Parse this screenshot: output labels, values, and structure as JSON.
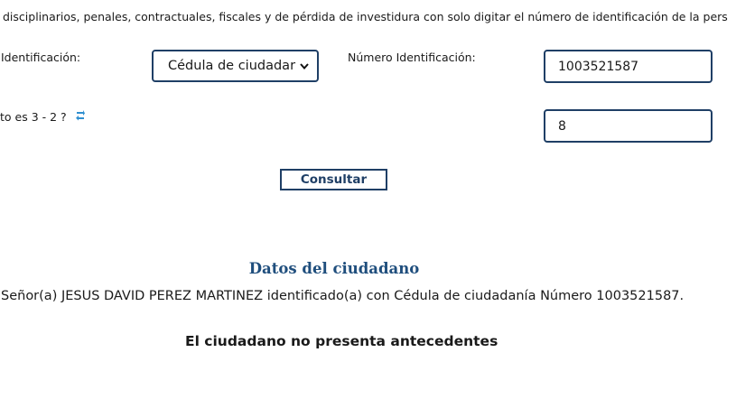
{
  "intro_text": "disciplinarios, penales, contractuales, fiscales y de pérdida de investidura con solo digitar el número de identificación de la pers",
  "form": {
    "id_type_label": "Identificación:",
    "id_type_selected": "Cédula de ciudadar",
    "id_number_label": "Número Identificación:",
    "id_number_value": "1003521587",
    "captcha_question": "to es 3 - 2 ?",
    "captcha_answer": "8",
    "submit_label": "Consultar"
  },
  "icons": {
    "dropdown": "chevron-down-icon",
    "refresh": "refresh-icon"
  },
  "results": {
    "section_title": "Datos del ciudadano",
    "citizen_text": "Señor(a)  JESUS DAVID PEREZ MARTINEZ identificado(a) con Cédula de ciudadanía Número 1003521587.",
    "status_text": "El ciudadano no presenta antecedentes"
  },
  "colors": {
    "accent": "#1f3f66",
    "title": "#1f4e7d",
    "refresh_icon": "#2f8fd0"
  }
}
